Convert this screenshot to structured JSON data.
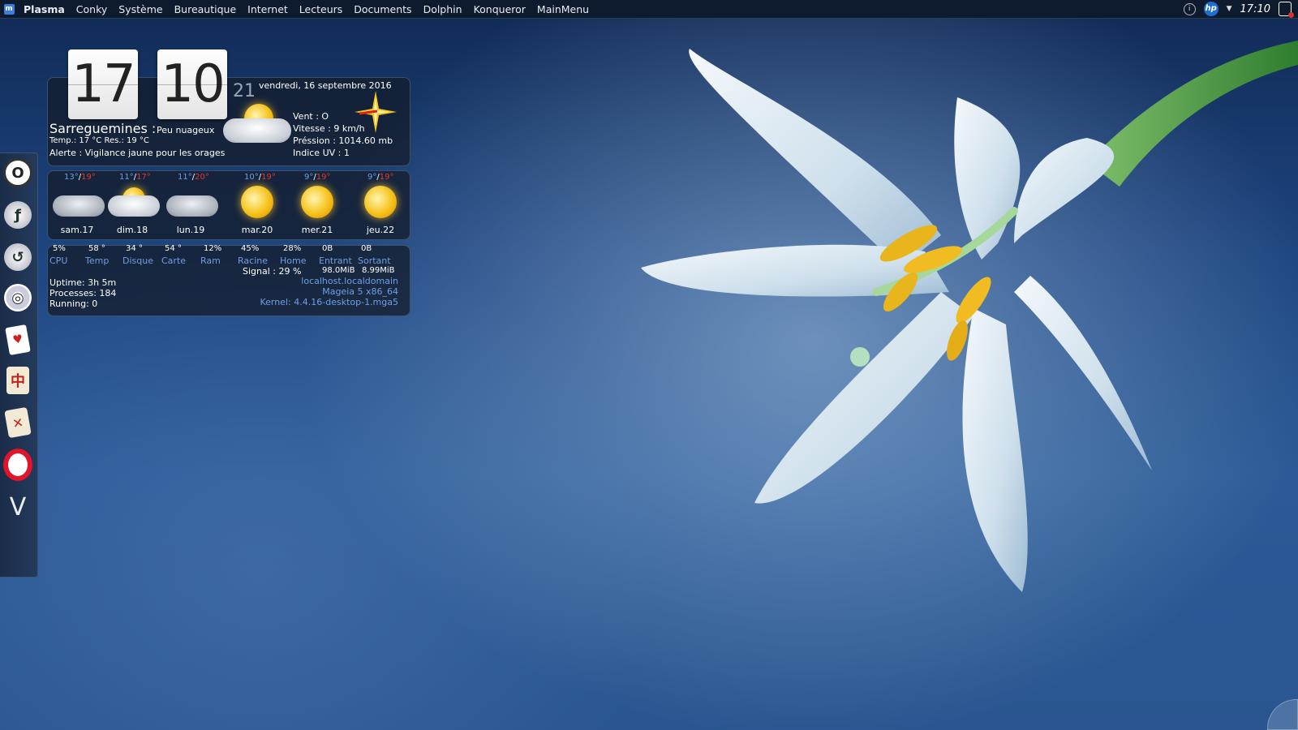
{
  "topbar": {
    "menu": [
      "Plasma",
      "Conky",
      "Système",
      "Bureautique",
      "Internet",
      "Lecteurs",
      "Documents",
      "Dolphin",
      "Konqueror",
      "MainMenu"
    ],
    "clock": "17:10",
    "hp_label": "hp"
  },
  "dock": {
    "items": [
      "opera-icon",
      "firefox-icon",
      "thunderbird-icon",
      "chrome-icon",
      "solitaire-cards-icon",
      "mahjong-tile-icon",
      "mahjong-tile-2-icon",
      "opera-red-icon",
      "vivaldi-icon"
    ]
  },
  "clock_widget": {
    "hours": "17",
    "minutes": "10",
    "seconds": "21"
  },
  "weather": {
    "date": "vendredi, 16 septembre 2016",
    "city": "Sarreguemines :",
    "condition": "Peu nuageux",
    "temp_line": "Temp.: 17 °C   Res.: 19 °C",
    "alert": "Alerte : Vigilance jaune pour les orages",
    "wind": "Vent : O",
    "speed": "Vitesse : 9 km/h",
    "pressure": "Préssion : 1014.60 mb",
    "uv": "Indice UV : 1"
  },
  "forecast": [
    {
      "min": "13°",
      "max": "19°",
      "day": "sam.17",
      "icon": "storm-cloud-icon"
    },
    {
      "min": "11°",
      "max": "17°",
      "day": "dim.18",
      "icon": "sun-cloud-icon"
    },
    {
      "min": "11°",
      "max": "20°",
      "day": "lun.19",
      "icon": "rain-cloud-icon"
    },
    {
      "min": "10°",
      "max": "19°",
      "day": "mar.20",
      "icon": "sun-icon"
    },
    {
      "min": "9°",
      "max": "19°",
      "day": "mer.21",
      "icon": "sun-icon"
    },
    {
      "min": "9°",
      "max": "19°",
      "day": "jeu.22",
      "icon": "sun-icon"
    }
  ],
  "system": {
    "stats": [
      {
        "value": "5%",
        "label": "CPU"
      },
      {
        "value": "58 °",
        "label": "Temp"
      },
      {
        "value": "34 °",
        "label": "Disque"
      },
      {
        "value": "54 °",
        "label": "Carte"
      },
      {
        "value": "12%",
        "label": "Ram"
      },
      {
        "value": "45%",
        "label": "Racine"
      },
      {
        "value": "28%",
        "label": "Home"
      },
      {
        "value": "0B",
        "label": "Entrant"
      },
      {
        "value": "0B",
        "label": "Sortant"
      }
    ],
    "signal": "Signal : 29 %",
    "net_in": "98.0MiB",
    "net_out": "8.99MiB",
    "host": "localhost.localdomain",
    "distro": "Mageia 5 x86_64",
    "kernel": "Kernel: 4.4.16-desktop-1.mga5",
    "uptime": "Uptime: 3h 5m",
    "processes": "Processes: 184",
    "running": "Running: 0"
  }
}
